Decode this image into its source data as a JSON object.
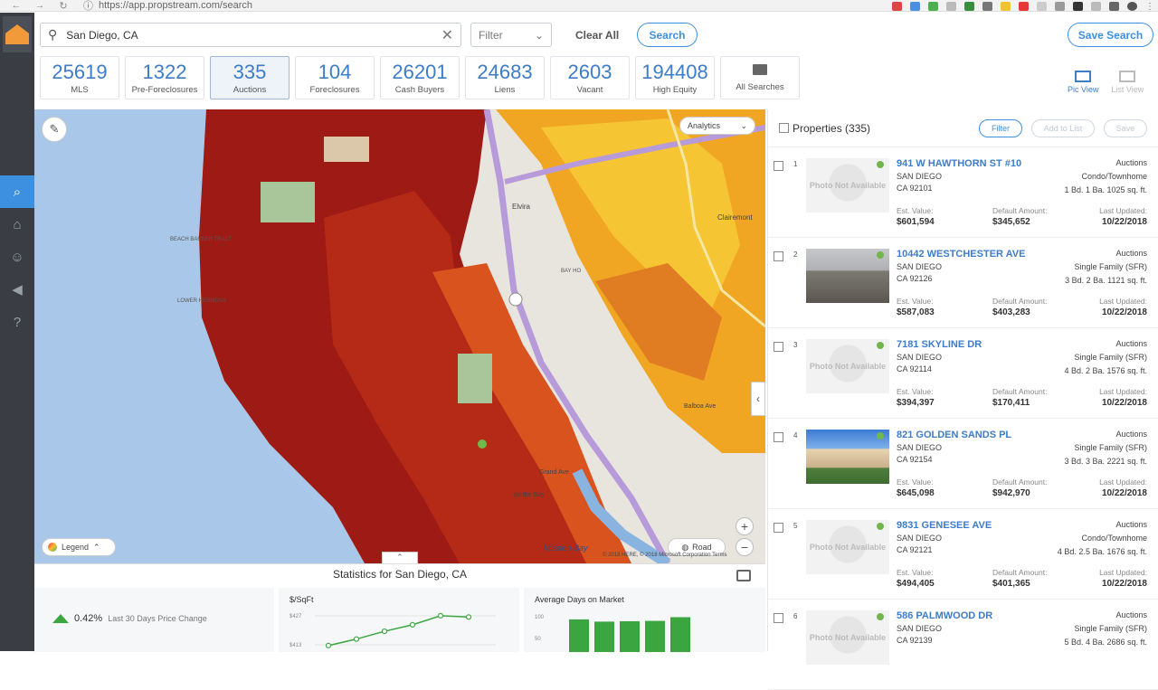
{
  "browser": {
    "url": "https://app.propstream.com/search"
  },
  "search": {
    "value": "San Diego, CA",
    "filter_label": "Filter",
    "clear_all": "Clear All",
    "search_label": "Search",
    "save_search": "Save Search"
  },
  "stats": [
    {
      "num": "25619",
      "label": "MLS"
    },
    {
      "num": "1322",
      "label": "Pre-Foreclosures"
    },
    {
      "num": "335",
      "label": "Auctions"
    },
    {
      "num": "104",
      "label": "Foreclosures"
    },
    {
      "num": "26201",
      "label": "Cash Buyers"
    },
    {
      "num": "24683",
      "label": "Liens"
    },
    {
      "num": "2603",
      "label": "Vacant"
    },
    {
      "num": "194408",
      "label": "High Equity"
    }
  ],
  "all_searches": "All Searches",
  "views": {
    "pic": "Pic View",
    "list": "List View"
  },
  "map": {
    "analytics": "Analytics",
    "legend": "Legend",
    "road": "Road",
    "copyright": "© 2018 HERE, © 2018 Microsoft Corporation Terms",
    "labels": {
      "l1": "BEACH BARBER TRACT",
      "l2": "LOWER HERMOSA",
      "l3": "Elvira",
      "l4": "Clairemont",
      "l5": "BAY HO",
      "l6": "Grand Ave",
      "l7": "Mission Bay",
      "l8": "Mission Bay",
      "l9": "Balboa Ave",
      "l10": "Crown Point",
      "l11": "Garnet Ave",
      "l12": "on the Bay"
    }
  },
  "statistics": {
    "title": "Statistics for San Diego, CA",
    "price_change_pct": "0.42%",
    "price_change_label": "Last 30 Days Price Change",
    "sqft_title": "$/SqFt",
    "sqft_ticks": [
      "$427",
      "$413"
    ],
    "dom_title": "Average Days on Market",
    "dom_ticks": [
      "100",
      "50"
    ]
  },
  "chart_data": [
    {
      "type": "line",
      "title": "$/SqFt",
      "x": [
        1,
        2,
        3,
        4,
        5,
        6
      ],
      "y": [
        405,
        410,
        416,
        421,
        428,
        427
      ]
    },
    {
      "type": "bar",
      "title": "Average Days on Market",
      "categories": [
        "1",
        "2",
        "3",
        "4",
        "5"
      ],
      "values": [
        88,
        82,
        83,
        84,
        94
      ]
    }
  ],
  "list": {
    "header": "Properties (335)",
    "filter": "Filter",
    "add_to_list": "Add to List",
    "save": "Save",
    "photo_na": "Photo Not Available",
    "k1": "Est. Value:",
    "k2": "Default Amount:",
    "k3": "Last Updated:",
    "items": [
      {
        "idx": "1",
        "addr": "941 W HAWTHORN ST #10",
        "city": "SAN DIEGO",
        "zip": "CA 92101",
        "type": "Auctions",
        "sub": "Condo/Townhome",
        "spec": "1 Bd.   1 Ba.   1025 sq. ft.",
        "est": "$601,594",
        "def": "$345,652",
        "upd": "10/22/2018"
      },
      {
        "idx": "2",
        "addr": "10442 WESTCHESTER AVE",
        "city": "SAN DIEGO",
        "zip": "CA 92126",
        "type": "Auctions",
        "sub": "Single Family (SFR)",
        "spec": "3 Bd.   2 Ba.   1121 sq. ft.",
        "est": "$587,083",
        "def": "$403,283",
        "upd": "10/22/2018"
      },
      {
        "idx": "3",
        "addr": "7181 SKYLINE DR",
        "city": "SAN DIEGO",
        "zip": "CA 92114",
        "type": "Auctions",
        "sub": "Single Family (SFR)",
        "spec": "4 Bd.   2 Ba.   1576 sq. ft.",
        "est": "$394,397",
        "def": "$170,411",
        "upd": "10/22/2018"
      },
      {
        "idx": "4",
        "addr": "821 GOLDEN SANDS PL",
        "city": "SAN DIEGO",
        "zip": "CA 92154",
        "type": "Auctions",
        "sub": "Single Family (SFR)",
        "spec": "3 Bd.   3 Ba.   2221 sq. ft.",
        "est": "$645,098",
        "def": "$942,970",
        "upd": "10/22/2018"
      },
      {
        "idx": "5",
        "addr": "9831 GENESEE AVE",
        "city": "SAN DIEGO",
        "zip": "CA 92121",
        "type": "Auctions",
        "sub": "Condo/Townhome",
        "spec": "4 Bd.   2.5 Ba.   1676 sq. ft.",
        "est": "$494,405",
        "def": "$401,365",
        "upd": "10/22/2018"
      },
      {
        "idx": "6",
        "addr": "586 PALMWOOD DR",
        "city": "SAN DIEGO",
        "zip": "CA 92139",
        "type": "Auctions",
        "sub": "Single Family (SFR)",
        "spec": "5 Bd.   4 Ba.   2686 sq. ft.",
        "est": "",
        "def": "",
        "upd": ""
      }
    ]
  }
}
